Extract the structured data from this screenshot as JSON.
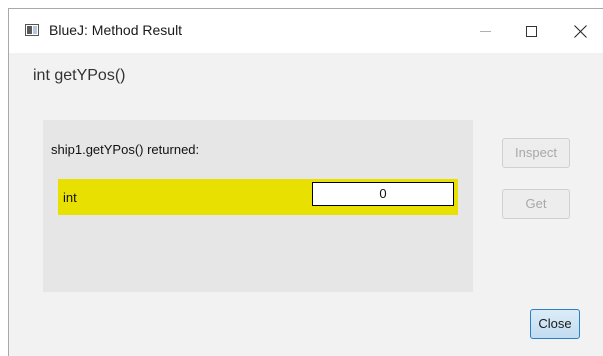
{
  "window": {
    "title": "BlueJ:  Method Result",
    "icon": "bluej-window-icon",
    "controls": {
      "minimize": "minimize-icon",
      "maximize": "maximize-icon",
      "close": "close-icon"
    }
  },
  "method": {
    "signature": "int getYPos()"
  },
  "result": {
    "returned_label": "ship1.getYPos() returned:",
    "type": "int",
    "value": "0",
    "highlight_color": "#e8e000"
  },
  "buttons": {
    "inspect_label": "Inspect",
    "get_label": "Get",
    "close_label": "Close"
  }
}
